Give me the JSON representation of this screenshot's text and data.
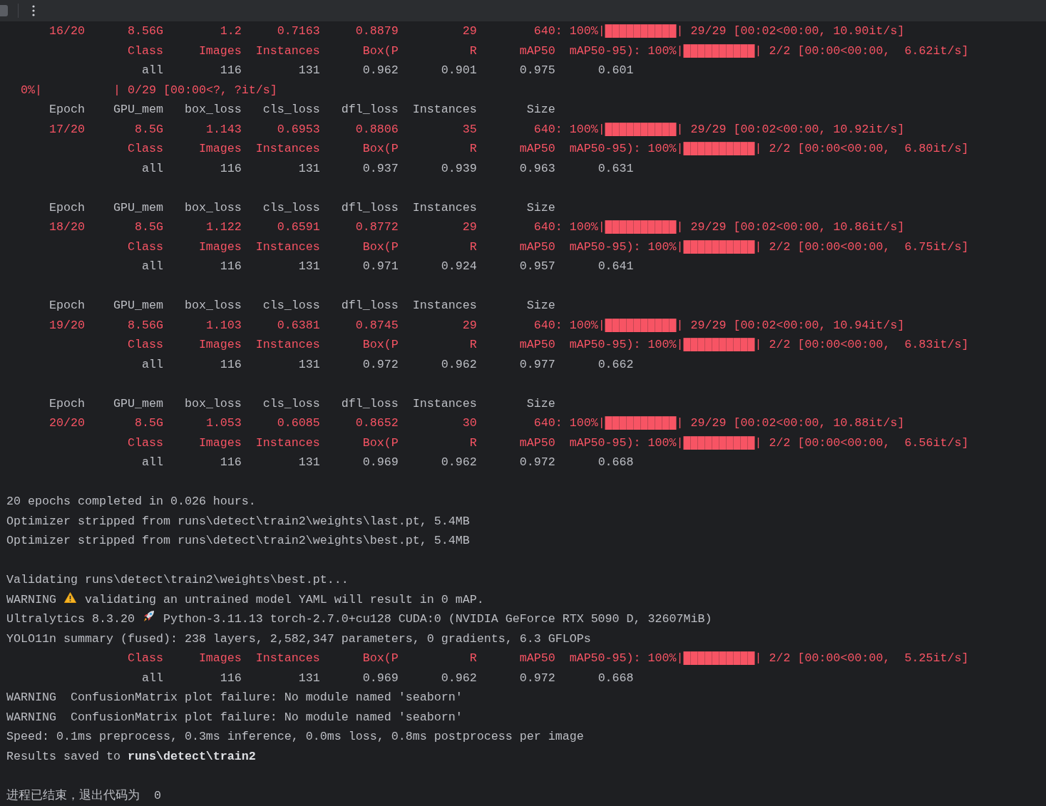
{
  "toolbar": {
    "stop_enabled": false
  },
  "lines": [
    {
      "kind": "output",
      "segments": [
        {
          "kind": "text",
          "color": "#f75464",
          "text": "      16/20      8.56G        1.2     0.7163     0.8879         29        640: 100%|██████████| 29/29 [00:02<00:00, 10.90it/s]"
        }
      ]
    },
    {
      "kind": "output",
      "segments": [
        {
          "kind": "text",
          "color": "#f75464",
          "text": "                 Class     Images  Instances      Box(P          R      mAP50  mAP50-95): 100%|██████████| 2/2 [00:00<00:00,  6.62it/s]"
        }
      ]
    },
    {
      "kind": "output",
      "segments": [
        {
          "kind": "text",
          "color": "#bcbec4",
          "text": "                   all        116        131      0.962      0.901      0.975      0.601"
        }
      ]
    },
    {
      "kind": "output",
      "segments": [
        {
          "kind": "text",
          "color": "#f75464",
          "text": "  0%|          | 0/29 [00:00<?, ?it/s]"
        }
      ]
    },
    {
      "kind": "output",
      "segments": [
        {
          "kind": "text",
          "color": "#bcbec4",
          "text": "      Epoch    GPU_mem   box_loss   cls_loss   dfl_loss  Instances       Size"
        }
      ]
    },
    {
      "kind": "output",
      "segments": [
        {
          "kind": "text",
          "color": "#f75464",
          "text": "      17/20       8.5G      1.143     0.6953     0.8806         35        640: 100%|██████████| 29/29 [00:02<00:00, 10.92it/s]"
        }
      ]
    },
    {
      "kind": "output",
      "segments": [
        {
          "kind": "text",
          "color": "#f75464",
          "text": "                 Class     Images  Instances      Box(P          R      mAP50  mAP50-95): 100%|██████████| 2/2 [00:00<00:00,  6.80it/s]"
        }
      ]
    },
    {
      "kind": "output",
      "segments": [
        {
          "kind": "text",
          "color": "#bcbec4",
          "text": "                   all        116        131      0.937      0.939      0.963      0.631"
        }
      ]
    },
    {
      "kind": "blank"
    },
    {
      "kind": "output",
      "segments": [
        {
          "kind": "text",
          "color": "#bcbec4",
          "text": "      Epoch    GPU_mem   box_loss   cls_loss   dfl_loss  Instances       Size"
        }
      ]
    },
    {
      "kind": "output",
      "segments": [
        {
          "kind": "text",
          "color": "#f75464",
          "text": "      18/20       8.5G      1.122     0.6591     0.8772         29        640: 100%|██████████| 29/29 [00:02<00:00, 10.86it/s]"
        }
      ]
    },
    {
      "kind": "output",
      "segments": [
        {
          "kind": "text",
          "color": "#f75464",
          "text": "                 Class     Images  Instances      Box(P          R      mAP50  mAP50-95): 100%|██████████| 2/2 [00:00<00:00,  6.75it/s]"
        }
      ]
    },
    {
      "kind": "output",
      "segments": [
        {
          "kind": "text",
          "color": "#bcbec4",
          "text": "                   all        116        131      0.971      0.924      0.957      0.641"
        }
      ]
    },
    {
      "kind": "blank"
    },
    {
      "kind": "output",
      "segments": [
        {
          "kind": "text",
          "color": "#bcbec4",
          "text": "      Epoch    GPU_mem   box_loss   cls_loss   dfl_loss  Instances       Size"
        }
      ]
    },
    {
      "kind": "output",
      "segments": [
        {
          "kind": "text",
          "color": "#f75464",
          "text": "      19/20      8.56G      1.103     0.6381     0.8745         29        640: 100%|██████████| 29/29 [00:02<00:00, 10.94it/s]"
        }
      ]
    },
    {
      "kind": "output",
      "segments": [
        {
          "kind": "text",
          "color": "#f75464",
          "text": "                 Class     Images  Instances      Box(P          R      mAP50  mAP50-95): 100%|██████████| 2/2 [00:00<00:00,  6.83it/s]"
        }
      ]
    },
    {
      "kind": "output",
      "segments": [
        {
          "kind": "text",
          "color": "#bcbec4",
          "text": "                   all        116        131      0.972      0.962      0.977      0.662"
        }
      ]
    },
    {
      "kind": "blank"
    },
    {
      "kind": "output",
      "segments": [
        {
          "kind": "text",
          "color": "#bcbec4",
          "text": "      Epoch    GPU_mem   box_loss   cls_loss   dfl_loss  Instances       Size"
        }
      ]
    },
    {
      "kind": "output",
      "segments": [
        {
          "kind": "text",
          "color": "#f75464",
          "text": "      20/20       8.5G      1.053     0.6085     0.8652         30        640: 100%|██████████| 29/29 [00:02<00:00, 10.88it/s]"
        }
      ]
    },
    {
      "kind": "output",
      "segments": [
        {
          "kind": "text",
          "color": "#f75464",
          "text": "                 Class     Images  Instances      Box(P          R      mAP50  mAP50-95): 100%|██████████| 2/2 [00:00<00:00,  6.56it/s]"
        }
      ]
    },
    {
      "kind": "output",
      "segments": [
        {
          "kind": "text",
          "color": "#bcbec4",
          "text": "                   all        116        131      0.969      0.962      0.972      0.668"
        }
      ]
    },
    {
      "kind": "blank"
    },
    {
      "kind": "output",
      "segments": [
        {
          "kind": "text",
          "color": "#bcbec4",
          "text": "20 epochs completed in 0.026 hours."
        }
      ]
    },
    {
      "kind": "output",
      "segments": [
        {
          "kind": "text",
          "color": "#bcbec4",
          "text": "Optimizer stripped from runs\\detect\\train2\\weights\\last.pt, 5.4MB"
        }
      ]
    },
    {
      "kind": "output",
      "segments": [
        {
          "kind": "text",
          "color": "#bcbec4",
          "text": "Optimizer stripped from runs\\detect\\train2\\weights\\best.pt, 5.4MB"
        }
      ]
    },
    {
      "kind": "blank"
    },
    {
      "kind": "output",
      "segments": [
        {
          "kind": "text",
          "color": "#bcbec4",
          "text": "Validating runs\\detect\\train2\\weights\\best.pt..."
        }
      ]
    },
    {
      "kind": "output",
      "segments": [
        {
          "kind": "text",
          "color": "#bcbec4",
          "text": "WARNING "
        },
        {
          "kind": "warning"
        },
        {
          "kind": "text",
          "color": "#bcbec4",
          "text": " validating an untrained model YAML will result in 0 mAP."
        }
      ]
    },
    {
      "kind": "output",
      "segments": [
        {
          "kind": "text",
          "color": "#bcbec4",
          "text": "Ultralytics 8.3.20 "
        },
        {
          "kind": "rocket"
        },
        {
          "kind": "text",
          "color": "#bcbec4",
          "text": " Python-3.11.13 torch-2.7.0+cu128 CUDA:0 (NVIDIA GeForce RTX 5090 D, 32607MiB)"
        }
      ]
    },
    {
      "kind": "output",
      "segments": [
        {
          "kind": "text",
          "color": "#bcbec4",
          "text": "YOLO11n summary (fused): 238 layers, 2,582,347 parameters, 0 gradients, 6.3 GFLOPs"
        }
      ]
    },
    {
      "kind": "output",
      "segments": [
        {
          "kind": "text",
          "color": "#f75464",
          "text": "                 Class     Images  Instances      Box(P          R      mAP50  mAP50-95): 100%|██████████| 2/2 [00:00<00:00,  5.25it/s]"
        }
      ]
    },
    {
      "kind": "output",
      "segments": [
        {
          "kind": "text",
          "color": "#bcbec4",
          "text": "                   all        116        131      0.969      0.962      0.972      0.668"
        }
      ]
    },
    {
      "kind": "output",
      "segments": [
        {
          "kind": "text",
          "color": "#bcbec4",
          "text": "WARNING  ConfusionMatrix plot failure: No module named 'seaborn'"
        }
      ]
    },
    {
      "kind": "output",
      "segments": [
        {
          "kind": "text",
          "color": "#bcbec4",
          "text": "WARNING  ConfusionMatrix plot failure: No module named 'seaborn'"
        }
      ]
    },
    {
      "kind": "output",
      "segments": [
        {
          "kind": "text",
          "color": "#bcbec4",
          "text": "Speed: 0.1ms preprocess, 0.3ms inference, 0.0ms loss, 0.8ms postprocess per image"
        }
      ]
    },
    {
      "kind": "output",
      "segments": [
        {
          "kind": "text",
          "color": "#bcbec4",
          "text": "Results saved to **runs\\detect\\train2**"
        }
      ]
    },
    {
      "kind": "blank"
    },
    {
      "kind": "output",
      "segments": [
        {
          "kind": "text",
          "color": "#bcbec4",
          "text": "进程已结束，退出代码为  0"
        }
      ]
    }
  ]
}
